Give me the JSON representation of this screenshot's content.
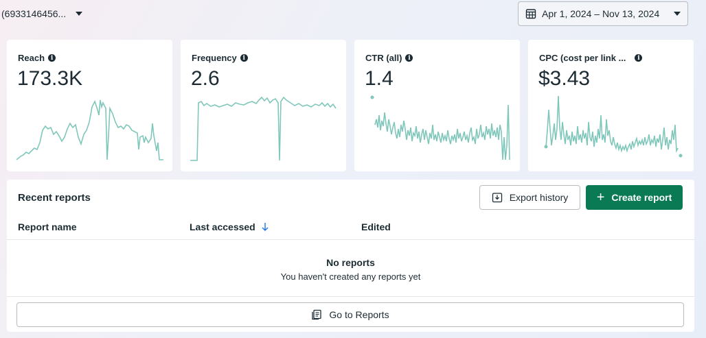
{
  "header": {
    "account_id": "(6933146456...",
    "date_range": "Apr 1, 2024 – Nov 13, 2024"
  },
  "metrics": [
    {
      "title": "Reach",
      "value": "173.3K"
    },
    {
      "title": "Frequency",
      "value": "2.6"
    },
    {
      "title": "CTR (all)",
      "value": "1.4"
    },
    {
      "title": "CPC (cost per link ...",
      "value": "$3.43"
    }
  ],
  "reports": {
    "title": "Recent reports",
    "export_label": "Export history",
    "create_label": "Create report",
    "columns": [
      "Report name",
      "Last accessed",
      "Edited"
    ],
    "empty_title": "No reports",
    "empty_subtitle": "You haven't created any reports yet",
    "goto_label": "Go to Reports"
  },
  "colors": {
    "sparkline": "#7fc7ba",
    "primary": "#0a7a55",
    "sort_arrow": "#1b74e4"
  }
}
